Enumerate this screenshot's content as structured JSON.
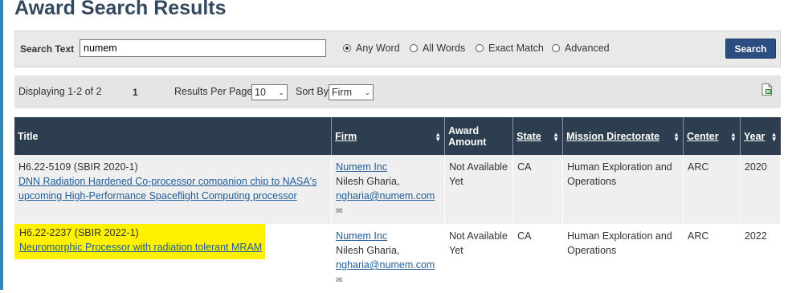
{
  "page": {
    "title": "Award Search Results"
  },
  "search": {
    "label": "Search Text",
    "value": "numem",
    "options": [
      {
        "label": "Any Word",
        "selected": true
      },
      {
        "label": "All Words",
        "selected": false
      },
      {
        "label": "Exact Match",
        "selected": false
      },
      {
        "label": "Advanced",
        "selected": false
      }
    ],
    "button_label": "Search"
  },
  "results_bar": {
    "displaying": "Displaying 1-2 of 2",
    "page": "1",
    "per_page_label": "Results Per Page",
    "per_page_value": "10",
    "sort_label": "Sort By",
    "sort_value": "Firm",
    "export_icon": "excel-export-icon"
  },
  "table": {
    "headers": [
      "Title",
      "Firm",
      "Award Amount",
      "State",
      "Mission Directorate",
      "Center",
      "Year"
    ],
    "rows": [
      {
        "code": "H6.22-5109 (SBIR 2020-1)",
        "title_link": "DNN Radiation Hardened Co-processor companion chip to NASA's upcoming High-Performance Spaceflight Computing processor",
        "firm": "Numem Inc",
        "contact": "Nilesh Gharia,",
        "email": "ngharia@numem.com",
        "amount": "Not Available Yet",
        "state": "CA",
        "directorate": "Human Exploration and Operations",
        "center": "ARC",
        "year": "2020"
      },
      {
        "code": "H6.22-2237 (SBIR 2022-1)",
        "title_link": "Neuromorphic Processor with radiation tolerant MRAM",
        "firm": "Numem Inc",
        "contact": "Nilesh Gharia,",
        "email": "ngharia@numem.com",
        "amount": "Not Available Yet",
        "state": "CA",
        "directorate": "Human Exploration and Operations",
        "center": "ARC",
        "year": "2022"
      }
    ]
  },
  "colors": {
    "header_bg": "#2c3e50",
    "search_button": "#2c4d80",
    "link": "#1f5c99",
    "highlight": "#fff100"
  }
}
